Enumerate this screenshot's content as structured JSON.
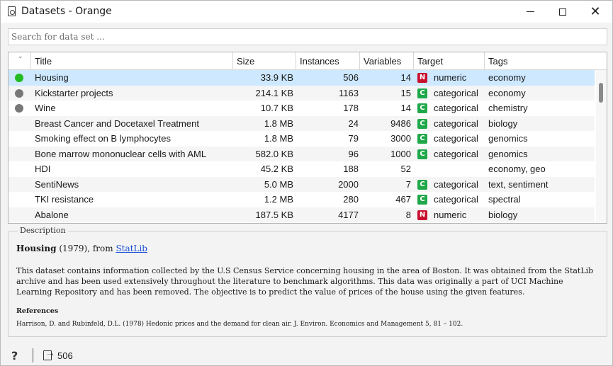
{
  "window": {
    "title": "Datasets - Orange",
    "minimize_glyph": "",
    "maximize_glyph": "",
    "close_glyph": "✕"
  },
  "search": {
    "placeholder": "Search for data set ..."
  },
  "table": {
    "sort_glyph": "⌄",
    "headers": [
      "Title",
      "Size",
      "Instances",
      "Variables",
      "Target",
      "Tags"
    ],
    "rows": [
      {
        "status": "loaded",
        "status_color": "#22bb22",
        "title": "Housing",
        "size": "33.9 KB",
        "instances": "506",
        "variables": "14",
        "badge": "N",
        "badge_color": "#c8102e",
        "target": "numeric",
        "tags": "economy",
        "selected": true
      },
      {
        "status": "downloaded",
        "status_color": "#777777",
        "title": "Kickstarter projects",
        "size": "214.1 KB",
        "instances": "1163",
        "variables": "15",
        "badge": "C",
        "badge_color": "#1fa84a",
        "target": "categorical",
        "tags": "economy",
        "selected": false
      },
      {
        "status": "downloaded",
        "status_color": "#777777",
        "title": "Wine",
        "size": "10.7 KB",
        "instances": "178",
        "variables": "14",
        "badge": "C",
        "badge_color": "#1fa84a",
        "target": "categorical",
        "tags": "chemistry",
        "selected": false
      },
      {
        "status": "",
        "status_color": "",
        "title": "Breast Cancer and Docetaxel Treatment",
        "size": "1.8 MB",
        "instances": "24",
        "variables": "9486",
        "badge": "C",
        "badge_color": "#1fa84a",
        "target": "categorical",
        "tags": "biology",
        "selected": false
      },
      {
        "status": "",
        "status_color": "",
        "title": "Smoking effect on B lymphocytes",
        "size": "1.8 MB",
        "instances": "79",
        "variables": "3000",
        "badge": "C",
        "badge_color": "#1fa84a",
        "target": "categorical",
        "tags": "genomics",
        "selected": false
      },
      {
        "status": "",
        "status_color": "",
        "title": "Bone marrow mononuclear cells with AML",
        "size": "582.0 KB",
        "instances": "96",
        "variables": "1000",
        "badge": "C",
        "badge_color": "#1fa84a",
        "target": "categorical",
        "tags": "genomics",
        "selected": false
      },
      {
        "status": "",
        "status_color": "",
        "title": "HDI",
        "size": "45.2 KB",
        "instances": "188",
        "variables": "52",
        "badge": "",
        "badge_color": "",
        "target": "",
        "tags": "economy, geo",
        "selected": false
      },
      {
        "status": "",
        "status_color": "",
        "title": "SentiNews",
        "size": "5.0 MB",
        "instances": "2000",
        "variables": "7",
        "badge": "C",
        "badge_color": "#1fa84a",
        "target": "categorical",
        "tags": "text, sentiment",
        "selected": false
      },
      {
        "status": "",
        "status_color": "",
        "title": "TKI resistance",
        "size": "1.2 MB",
        "instances": "280",
        "variables": "467",
        "badge": "C",
        "badge_color": "#1fa84a",
        "target": "categorical",
        "tags": "spectral",
        "selected": false
      },
      {
        "status": "",
        "status_color": "",
        "title": "Abalone",
        "size": "187.5 KB",
        "instances": "4177",
        "variables": "8",
        "badge": "N",
        "badge_color": "#c8102e",
        "target": "numeric",
        "tags": "biology",
        "selected": false
      }
    ]
  },
  "description": {
    "label": "Description",
    "name": "Housing",
    "year_text": " (1979), from ",
    "source": "StatLib",
    "body": "This dataset contains information collected by the U.S Census Service concerning housing in the area of Boston. It was obtained from the StatLib archive and has been used extensively throughout the literature to benchmark algorithms. This data was originally a part of UCI Machine Learning Repository and has been removed. The objective is to predict the value of prices of the house using the given features.",
    "references_title": "References",
    "references_text": "Harrison, D. and Rubinfeld, D.L. (1978) Hedonic prices and the demand for clean air. J. Environ. Economics and Management 5, 81 – 102."
  },
  "status": {
    "help_glyph": "?",
    "output_count": "506"
  }
}
